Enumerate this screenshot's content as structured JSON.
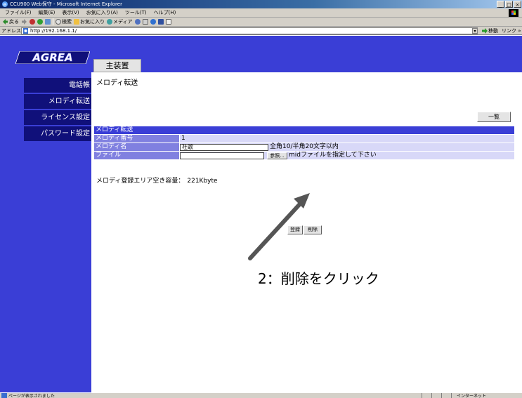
{
  "window": {
    "title": "CCU900 Web保守 - Microsoft Internet Explorer",
    "controls": [
      "_",
      "□",
      "×"
    ]
  },
  "menu": [
    "ファイル(F)",
    "編集(E)",
    "表示(V)",
    "お気に入り(A)",
    "ツール(T)",
    "ヘルプ(H)"
  ],
  "toolbar": {
    "back": "戻る",
    "search": "検索",
    "favorites": "お気に入り",
    "media": "メディア"
  },
  "address": {
    "label": "アドレス(D)",
    "url": "http://192.168.1.1/",
    "go": "移動",
    "links": "リンク »"
  },
  "nav": {
    "logo": "AGREA",
    "items": [
      "電話帳",
      "メロディ転送",
      "ライセンス設定",
      "パスワード設定"
    ]
  },
  "tabs": {
    "main": "主装置"
  },
  "page": {
    "heading": "メロディ転送",
    "list_button": "一覧",
    "form": {
      "header": "メロディ転送",
      "rows": [
        {
          "label": "メロディ番号",
          "value": "1"
        },
        {
          "label": "メロディ名",
          "value": "社歌",
          "hint": "全角10/半角20文字以内"
        },
        {
          "label": "ファイル",
          "value": "",
          "browse": "参照...",
          "hint": "midファイルを指定して下さい"
        }
      ]
    },
    "capacity_label": "メロディ登録エリア空き容量：",
    "capacity_value": "221Kbyte",
    "register_button": "登録",
    "delete_button": "削除"
  },
  "annotation": {
    "text": "2：削除をクリック",
    "color": "#555555"
  },
  "status": {
    "text": "ページが表示されました",
    "zone": "インターネット"
  },
  "colors": {
    "nav_bg": "#3a3ed6",
    "nav_btn": "#10107a",
    "form_header": "#3a3ed6",
    "form_label": "#8080e0",
    "form_value": "#d8d8f8"
  }
}
